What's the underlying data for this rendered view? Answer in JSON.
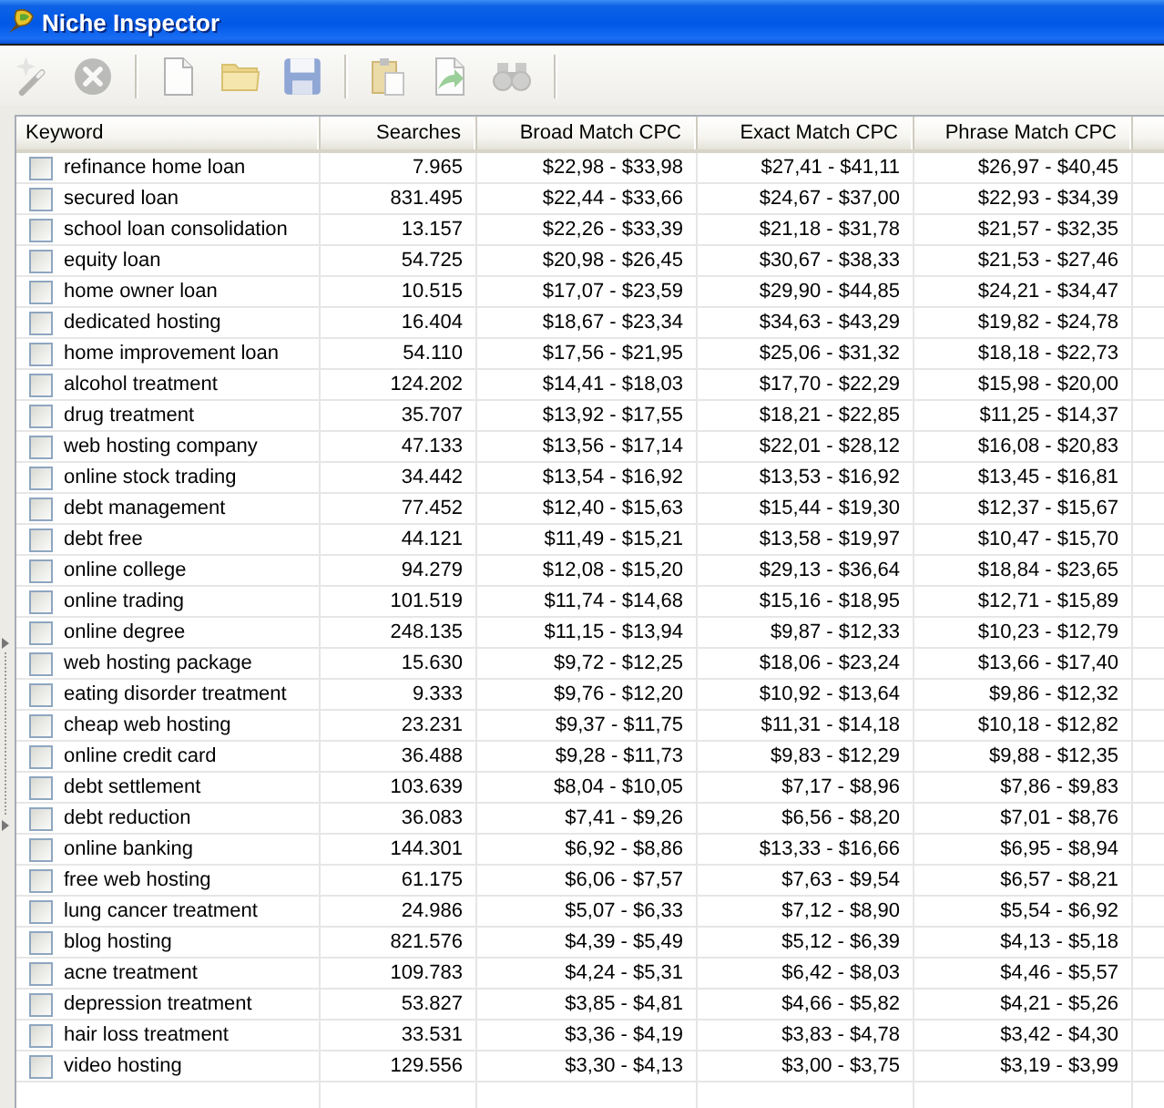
{
  "window": {
    "title": "Niche Inspector"
  },
  "toolbar": {
    "groups": [
      [
        {
          "kind": "wizard",
          "disabled": true
        },
        {
          "kind": "cancel",
          "disabled": true
        }
      ],
      [
        {
          "kind": "new",
          "disabled": false
        },
        {
          "kind": "open",
          "disabled": false
        },
        {
          "kind": "save",
          "disabled": false
        }
      ],
      [
        {
          "kind": "paste",
          "disabled": false
        },
        {
          "kind": "export",
          "disabled": false
        },
        {
          "kind": "find",
          "disabled": true
        }
      ]
    ]
  },
  "table": {
    "columns": [
      "Keyword",
      "Searches",
      "Broad Match CPC",
      "Exact Match CPC",
      "Phrase Match CPC"
    ],
    "rows": [
      {
        "checked": false,
        "keyword": "refinance home loan",
        "searches": "7.965",
        "broad_match_cpc": "$22,98 - $33,98",
        "exact_match_cpc": "$27,41 - $41,11",
        "phrase_match_cpc": "$26,97 - $40,45"
      },
      {
        "checked": false,
        "keyword": "secured loan",
        "searches": "831.495",
        "broad_match_cpc": "$22,44 - $33,66",
        "exact_match_cpc": "$24,67 - $37,00",
        "phrase_match_cpc": "$22,93 - $34,39"
      },
      {
        "checked": false,
        "keyword": "school loan consolidation",
        "searches": "13.157",
        "broad_match_cpc": "$22,26 - $33,39",
        "exact_match_cpc": "$21,18 - $31,78",
        "phrase_match_cpc": "$21,57 - $32,35"
      },
      {
        "checked": false,
        "keyword": "equity loan",
        "searches": "54.725",
        "broad_match_cpc": "$20,98 - $26,45",
        "exact_match_cpc": "$30,67 - $38,33",
        "phrase_match_cpc": "$21,53 - $27,46"
      },
      {
        "checked": false,
        "keyword": "home owner loan",
        "searches": "10.515",
        "broad_match_cpc": "$17,07 - $23,59",
        "exact_match_cpc": "$29,90 - $44,85",
        "phrase_match_cpc": "$24,21 - $34,47"
      },
      {
        "checked": false,
        "keyword": "dedicated hosting",
        "searches": "16.404",
        "broad_match_cpc": "$18,67 - $23,34",
        "exact_match_cpc": "$34,63 - $43,29",
        "phrase_match_cpc": "$19,82 - $24,78"
      },
      {
        "checked": false,
        "keyword": "home improvement loan",
        "searches": "54.110",
        "broad_match_cpc": "$17,56 - $21,95",
        "exact_match_cpc": "$25,06 - $31,32",
        "phrase_match_cpc": "$18,18 - $22,73"
      },
      {
        "checked": false,
        "keyword": "alcohol treatment",
        "searches": "124.202",
        "broad_match_cpc": "$14,41 - $18,03",
        "exact_match_cpc": "$17,70 - $22,29",
        "phrase_match_cpc": "$15,98 - $20,00"
      },
      {
        "checked": false,
        "keyword": "drug treatment",
        "searches": "35.707",
        "broad_match_cpc": "$13,92 - $17,55",
        "exact_match_cpc": "$18,21 - $22,85",
        "phrase_match_cpc": "$11,25 - $14,37"
      },
      {
        "checked": false,
        "keyword": "web hosting company",
        "searches": "47.133",
        "broad_match_cpc": "$13,56 - $17,14",
        "exact_match_cpc": "$22,01 - $28,12",
        "phrase_match_cpc": "$16,08 - $20,83"
      },
      {
        "checked": false,
        "keyword": "online stock trading",
        "searches": "34.442",
        "broad_match_cpc": "$13,54 - $16,92",
        "exact_match_cpc": "$13,53 - $16,92",
        "phrase_match_cpc": "$13,45 - $16,81"
      },
      {
        "checked": false,
        "keyword": "debt management",
        "searches": "77.452",
        "broad_match_cpc": "$12,40 - $15,63",
        "exact_match_cpc": "$15,44 - $19,30",
        "phrase_match_cpc": "$12,37 - $15,67"
      },
      {
        "checked": false,
        "keyword": "debt free",
        "searches": "44.121",
        "broad_match_cpc": "$11,49 - $15,21",
        "exact_match_cpc": "$13,58 - $19,97",
        "phrase_match_cpc": "$10,47 - $15,70"
      },
      {
        "checked": false,
        "keyword": "online college",
        "searches": "94.279",
        "broad_match_cpc": "$12,08 - $15,20",
        "exact_match_cpc": "$29,13 - $36,64",
        "phrase_match_cpc": "$18,84 - $23,65"
      },
      {
        "checked": false,
        "keyword": "online trading",
        "searches": "101.519",
        "broad_match_cpc": "$11,74 - $14,68",
        "exact_match_cpc": "$15,16 - $18,95",
        "phrase_match_cpc": "$12,71 - $15,89"
      },
      {
        "checked": false,
        "keyword": "online degree",
        "searches": "248.135",
        "broad_match_cpc": "$11,15 - $13,94",
        "exact_match_cpc": "$9,87 - $12,33",
        "phrase_match_cpc": "$10,23 - $12,79"
      },
      {
        "checked": false,
        "keyword": "web hosting package",
        "searches": "15.630",
        "broad_match_cpc": "$9,72 - $12,25",
        "exact_match_cpc": "$18,06 - $23,24",
        "phrase_match_cpc": "$13,66 - $17,40"
      },
      {
        "checked": false,
        "keyword": "eating disorder treatment",
        "searches": "9.333",
        "broad_match_cpc": "$9,76 - $12,20",
        "exact_match_cpc": "$10,92 - $13,64",
        "phrase_match_cpc": "$9,86 - $12,32"
      },
      {
        "checked": false,
        "keyword": "cheap web hosting",
        "searches": "23.231",
        "broad_match_cpc": "$9,37 - $11,75",
        "exact_match_cpc": "$11,31 - $14,18",
        "phrase_match_cpc": "$10,18 - $12,82"
      },
      {
        "checked": false,
        "keyword": "online credit card",
        "searches": "36.488",
        "broad_match_cpc": "$9,28 - $11,73",
        "exact_match_cpc": "$9,83 - $12,29",
        "phrase_match_cpc": "$9,88 - $12,35"
      },
      {
        "checked": false,
        "keyword": "debt settlement",
        "searches": "103.639",
        "broad_match_cpc": "$8,04 - $10,05",
        "exact_match_cpc": "$7,17 - $8,96",
        "phrase_match_cpc": "$7,86 - $9,83"
      },
      {
        "checked": false,
        "keyword": "debt reduction",
        "searches": "36.083",
        "broad_match_cpc": "$7,41 - $9,26",
        "exact_match_cpc": "$6,56 - $8,20",
        "phrase_match_cpc": "$7,01 - $8,76"
      },
      {
        "checked": false,
        "keyword": "online banking",
        "searches": "144.301",
        "broad_match_cpc": "$6,92 - $8,86",
        "exact_match_cpc": "$13,33 - $16,66",
        "phrase_match_cpc": "$6,95 - $8,94"
      },
      {
        "checked": false,
        "keyword": "free web hosting",
        "searches": "61.175",
        "broad_match_cpc": "$6,06 - $7,57",
        "exact_match_cpc": "$7,63 - $9,54",
        "phrase_match_cpc": "$6,57 - $8,21"
      },
      {
        "checked": false,
        "keyword": "lung cancer treatment",
        "searches": "24.986",
        "broad_match_cpc": "$5,07 - $6,33",
        "exact_match_cpc": "$7,12 - $8,90",
        "phrase_match_cpc": "$5,54 - $6,92"
      },
      {
        "checked": false,
        "keyword": "blog hosting",
        "searches": "821.576",
        "broad_match_cpc": "$4,39 - $5,49",
        "exact_match_cpc": "$5,12 - $6,39",
        "phrase_match_cpc": "$4,13 - $5,18"
      },
      {
        "checked": false,
        "keyword": "acne treatment",
        "searches": "109.783",
        "broad_match_cpc": "$4,24 - $5,31",
        "exact_match_cpc": "$6,42 - $8,03",
        "phrase_match_cpc": "$4,46 - $5,57"
      },
      {
        "checked": false,
        "keyword": "depression treatment",
        "searches": "53.827",
        "broad_match_cpc": "$3,85 - $4,81",
        "exact_match_cpc": "$4,66 - $5,82",
        "phrase_match_cpc": "$4,21 - $5,26"
      },
      {
        "checked": false,
        "keyword": "hair loss treatment",
        "searches": "33.531",
        "broad_match_cpc": "$3,36 - $4,19",
        "exact_match_cpc": "$3,83 - $4,78",
        "phrase_match_cpc": "$3,42 - $4,30"
      },
      {
        "checked": false,
        "keyword": "video hosting",
        "searches": "129.556",
        "broad_match_cpc": "$3,30 - $4,13",
        "exact_match_cpc": "$3,00 - $3,75",
        "phrase_match_cpc": "$3,19 - $3,99"
      }
    ]
  }
}
